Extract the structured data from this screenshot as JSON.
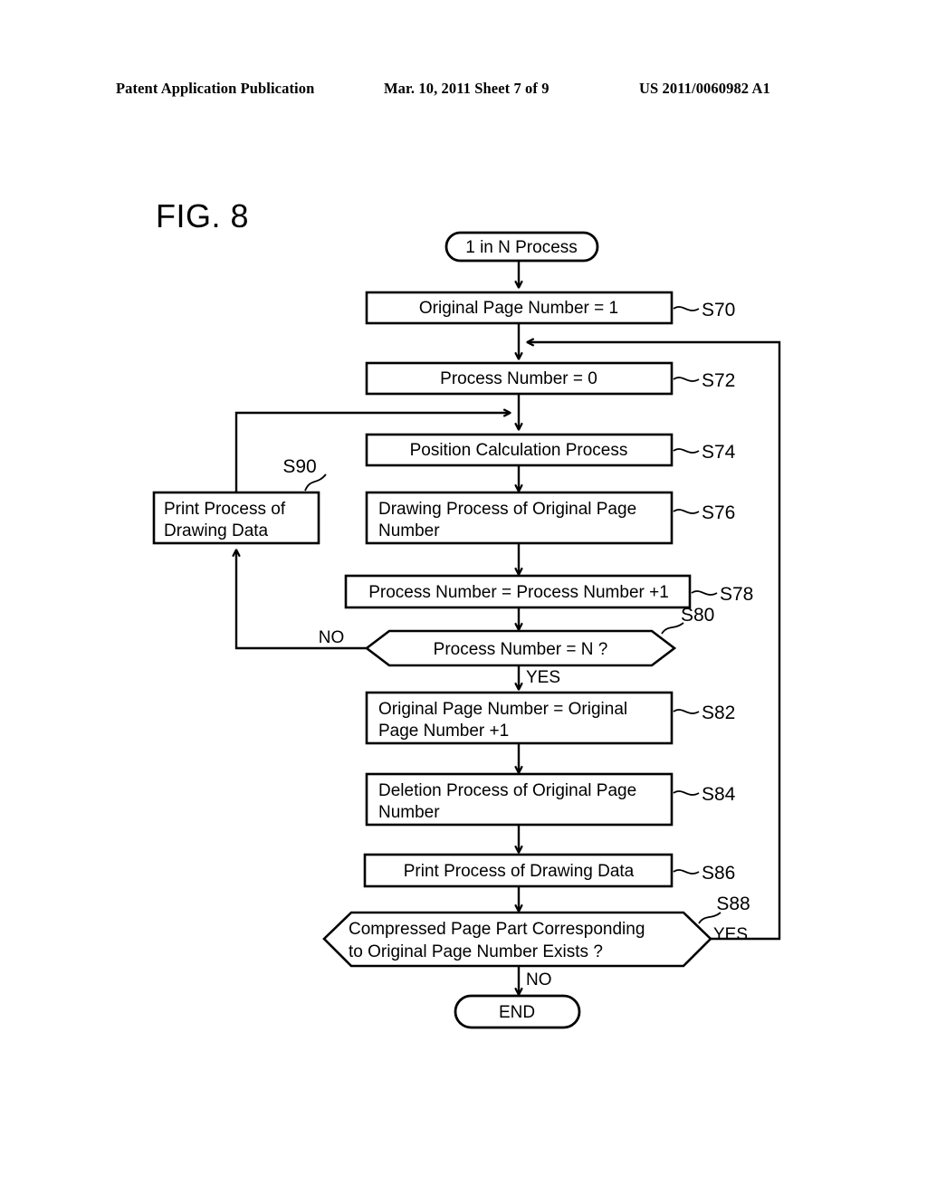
{
  "header": {
    "publication": "Patent Application Publication",
    "date_sheet": "Mar. 10, 2011  Sheet 7 of 9",
    "patent_number": "US 2011/0060982 A1"
  },
  "figure": {
    "title": "FIG. 8"
  },
  "flowchart": {
    "start": {
      "label": "1 in N Process"
    },
    "end": {
      "label": "END"
    },
    "steps": [
      {
        "id": "S70",
        "text": "Original Page Number = 1",
        "tag": "S70"
      },
      {
        "id": "S72",
        "text": "Process Number = 0",
        "tag": "S72"
      },
      {
        "id": "S74",
        "text": "Position Calculation Process",
        "tag": "S74"
      },
      {
        "id": "S76",
        "text": "Drawing Process of Original Page Number",
        "tag": "S76"
      },
      {
        "id": "S78",
        "text": "Process Number = Process Number +1",
        "tag": "S78"
      },
      {
        "id": "S82",
        "text": "Original Page Number = Original Page Number +1",
        "tag": "S82"
      },
      {
        "id": "S84",
        "text": "Deletion Process of Original Page Number",
        "tag": "S84"
      },
      {
        "id": "S86",
        "text": "Print Process of Drawing Data",
        "tag": "S86"
      },
      {
        "id": "S90",
        "text": "Print Process of Drawing Data",
        "tag": "S90"
      }
    ],
    "decisions": [
      {
        "id": "S80",
        "text": "Process Number = N ?",
        "tag": "S80",
        "yes": "YES",
        "no": "NO"
      },
      {
        "id": "S88",
        "text_line1": "Compressed Page Part Corresponding",
        "text_line2": "to Original Page Number Exists ?",
        "tag": "S88",
        "yes": "YES",
        "no": "NO"
      }
    ],
    "box_text": {
      "s76_line1": "Drawing Process of Original Page",
      "s76_line2": "Number",
      "s82_line1": "Original Page Number = Original",
      "s82_line2": "Page Number +1",
      "s84_line1": "Deletion Process of Original Page",
      "s84_line2": "Number",
      "s90_line1": "Print Process of",
      "s90_line2": "Drawing Data"
    },
    "colors": {
      "ink": "#000000",
      "paper": "#ffffff"
    }
  }
}
